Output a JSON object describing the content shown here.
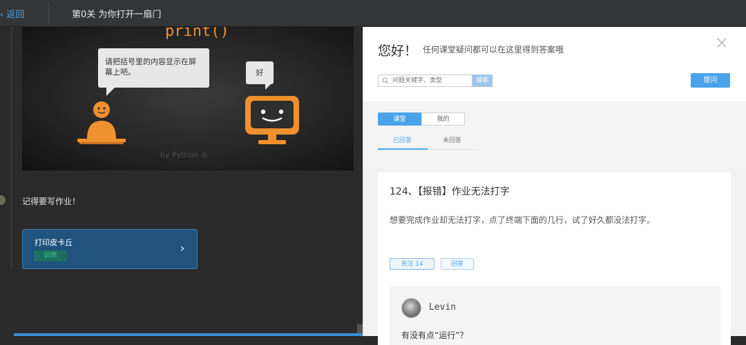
{
  "topbar": {
    "back_label": "返回",
    "level_title": "第0关  为你打开一扇门"
  },
  "lesson": {
    "print_title": "print()",
    "bubble_left": "请把括号里的内容显示在屏幕上吧。",
    "bubble_right": "好",
    "watermark": "by Python ®",
    "reminder": "记得要写作业！",
    "task": {
      "title": "打印皮卡丘",
      "tag": "训练"
    },
    "colors": {
      "accent_orange": "#f0912f",
      "task_blue": "#20537e",
      "tag_green": "#36c98a"
    }
  },
  "qa_panel": {
    "greeting": "您好！",
    "greeting_sub": "任何课堂疑问都可以在这里得到答案哦",
    "search_placeholder": "问题关键字、类型",
    "search_button": "搜索",
    "ask_button": "提问",
    "segment_tabs": [
      {
        "label": "课堂",
        "active": true
      },
      {
        "label": "我的",
        "active": false
      }
    ],
    "sub_tabs": [
      {
        "label": "已回答",
        "active": true
      },
      {
        "label": "未回答",
        "active": false
      }
    ],
    "question": {
      "title": "124、【报错】作业无法打字",
      "body": "想要完成作业却无法打字，点了终端下面的几行，试了好久都没法打字。",
      "follow_label": "关注  14",
      "answer_label": "回答"
    },
    "reply": {
      "author": "Levin",
      "text": "有没有点“运行”？"
    },
    "colors": {
      "accent_blue": "#4aa3e8"
    }
  }
}
